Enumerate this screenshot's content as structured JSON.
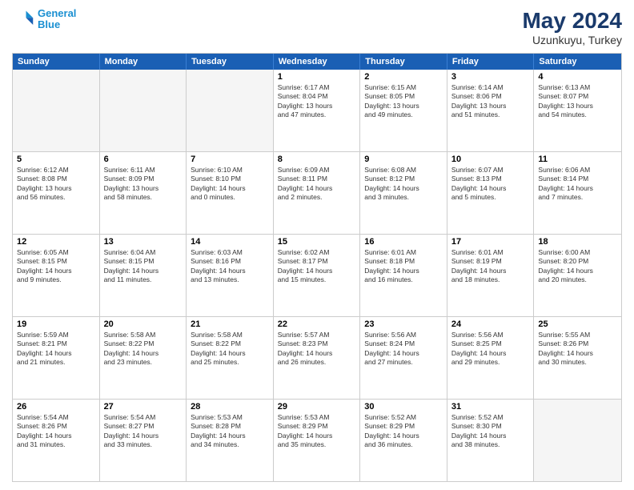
{
  "logo": {
    "line1": "General",
    "line2": "Blue"
  },
  "title": "May 2024",
  "location": "Uzunkuyu, Turkey",
  "dayHeaders": [
    "Sunday",
    "Monday",
    "Tuesday",
    "Wednesday",
    "Thursday",
    "Friday",
    "Saturday"
  ],
  "weeks": [
    {
      "days": [
        {
          "num": "",
          "info": "",
          "empty": true
        },
        {
          "num": "",
          "info": "",
          "empty": true
        },
        {
          "num": "",
          "info": "",
          "empty": true
        },
        {
          "num": "1",
          "info": "Sunrise: 6:17 AM\nSunset: 8:04 PM\nDaylight: 13 hours\nand 47 minutes."
        },
        {
          "num": "2",
          "info": "Sunrise: 6:15 AM\nSunset: 8:05 PM\nDaylight: 13 hours\nand 49 minutes."
        },
        {
          "num": "3",
          "info": "Sunrise: 6:14 AM\nSunset: 8:06 PM\nDaylight: 13 hours\nand 51 minutes."
        },
        {
          "num": "4",
          "info": "Sunrise: 6:13 AM\nSunset: 8:07 PM\nDaylight: 13 hours\nand 54 minutes."
        }
      ]
    },
    {
      "days": [
        {
          "num": "5",
          "info": "Sunrise: 6:12 AM\nSunset: 8:08 PM\nDaylight: 13 hours\nand 56 minutes."
        },
        {
          "num": "6",
          "info": "Sunrise: 6:11 AM\nSunset: 8:09 PM\nDaylight: 13 hours\nand 58 minutes."
        },
        {
          "num": "7",
          "info": "Sunrise: 6:10 AM\nSunset: 8:10 PM\nDaylight: 14 hours\nand 0 minutes."
        },
        {
          "num": "8",
          "info": "Sunrise: 6:09 AM\nSunset: 8:11 PM\nDaylight: 14 hours\nand 2 minutes."
        },
        {
          "num": "9",
          "info": "Sunrise: 6:08 AM\nSunset: 8:12 PM\nDaylight: 14 hours\nand 3 minutes."
        },
        {
          "num": "10",
          "info": "Sunrise: 6:07 AM\nSunset: 8:13 PM\nDaylight: 14 hours\nand 5 minutes."
        },
        {
          "num": "11",
          "info": "Sunrise: 6:06 AM\nSunset: 8:14 PM\nDaylight: 14 hours\nand 7 minutes."
        }
      ]
    },
    {
      "days": [
        {
          "num": "12",
          "info": "Sunrise: 6:05 AM\nSunset: 8:15 PM\nDaylight: 14 hours\nand 9 minutes."
        },
        {
          "num": "13",
          "info": "Sunrise: 6:04 AM\nSunset: 8:15 PM\nDaylight: 14 hours\nand 11 minutes."
        },
        {
          "num": "14",
          "info": "Sunrise: 6:03 AM\nSunset: 8:16 PM\nDaylight: 14 hours\nand 13 minutes."
        },
        {
          "num": "15",
          "info": "Sunrise: 6:02 AM\nSunset: 8:17 PM\nDaylight: 14 hours\nand 15 minutes."
        },
        {
          "num": "16",
          "info": "Sunrise: 6:01 AM\nSunset: 8:18 PM\nDaylight: 14 hours\nand 16 minutes."
        },
        {
          "num": "17",
          "info": "Sunrise: 6:01 AM\nSunset: 8:19 PM\nDaylight: 14 hours\nand 18 minutes."
        },
        {
          "num": "18",
          "info": "Sunrise: 6:00 AM\nSunset: 8:20 PM\nDaylight: 14 hours\nand 20 minutes."
        }
      ]
    },
    {
      "days": [
        {
          "num": "19",
          "info": "Sunrise: 5:59 AM\nSunset: 8:21 PM\nDaylight: 14 hours\nand 21 minutes."
        },
        {
          "num": "20",
          "info": "Sunrise: 5:58 AM\nSunset: 8:22 PM\nDaylight: 14 hours\nand 23 minutes."
        },
        {
          "num": "21",
          "info": "Sunrise: 5:58 AM\nSunset: 8:22 PM\nDaylight: 14 hours\nand 25 minutes."
        },
        {
          "num": "22",
          "info": "Sunrise: 5:57 AM\nSunset: 8:23 PM\nDaylight: 14 hours\nand 26 minutes."
        },
        {
          "num": "23",
          "info": "Sunrise: 5:56 AM\nSunset: 8:24 PM\nDaylight: 14 hours\nand 27 minutes."
        },
        {
          "num": "24",
          "info": "Sunrise: 5:56 AM\nSunset: 8:25 PM\nDaylight: 14 hours\nand 29 minutes."
        },
        {
          "num": "25",
          "info": "Sunrise: 5:55 AM\nSunset: 8:26 PM\nDaylight: 14 hours\nand 30 minutes."
        }
      ]
    },
    {
      "days": [
        {
          "num": "26",
          "info": "Sunrise: 5:54 AM\nSunset: 8:26 PM\nDaylight: 14 hours\nand 31 minutes."
        },
        {
          "num": "27",
          "info": "Sunrise: 5:54 AM\nSunset: 8:27 PM\nDaylight: 14 hours\nand 33 minutes."
        },
        {
          "num": "28",
          "info": "Sunrise: 5:53 AM\nSunset: 8:28 PM\nDaylight: 14 hours\nand 34 minutes."
        },
        {
          "num": "29",
          "info": "Sunrise: 5:53 AM\nSunset: 8:29 PM\nDaylight: 14 hours\nand 35 minutes."
        },
        {
          "num": "30",
          "info": "Sunrise: 5:52 AM\nSunset: 8:29 PM\nDaylight: 14 hours\nand 36 minutes."
        },
        {
          "num": "31",
          "info": "Sunrise: 5:52 AM\nSunset: 8:30 PM\nDaylight: 14 hours\nand 38 minutes."
        },
        {
          "num": "",
          "info": "",
          "empty": true
        }
      ]
    }
  ]
}
